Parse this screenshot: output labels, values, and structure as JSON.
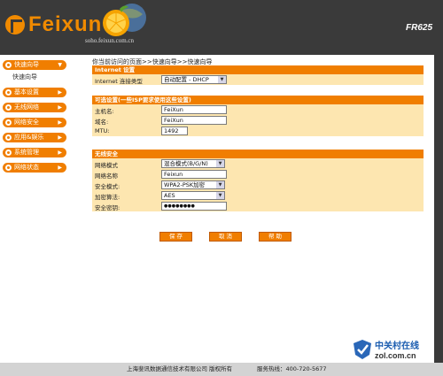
{
  "header": {
    "logo_text": "Feixun",
    "model": "FR625",
    "site": "soho.feixun.com.cn"
  },
  "sidebar": {
    "items": [
      {
        "label": "快速向导",
        "arrow": "▼",
        "sub": [
          "快速向导"
        ]
      },
      {
        "label": "基本设置",
        "arrow": "▶"
      },
      {
        "label": "无线网络",
        "arrow": "▶"
      },
      {
        "label": "网络安全",
        "arrow": "▶"
      },
      {
        "label": "应用&娱乐",
        "arrow": "▶"
      },
      {
        "label": "系统管理",
        "arrow": "▶"
      },
      {
        "label": "网络状态",
        "arrow": "▶"
      }
    ]
  },
  "breadcrumb": "你当前访问的页面>>快速向导>>快速向导",
  "internet": {
    "title": "Internet 设置",
    "conn_label": "Internet 连接类型",
    "conn_value": "自动配置 - DHCP"
  },
  "optional": {
    "title": "可选设置(一些ISP要求使用这些设置)",
    "host_label": "主机名:",
    "host_value": "FeiXun",
    "domain_label": "域名:",
    "domain_value": "FeiXun",
    "mtu_label": "MTU:",
    "mtu_value": "1492"
  },
  "wireless": {
    "title": "无线安全",
    "mode_label": "网络模式",
    "mode_value": "混合模式(B/G/N)",
    "ssid_label": "网络名称",
    "ssid_value": "Feixun",
    "security_label": "安全模式:",
    "security_value": "WPA2-PSK加密",
    "cipher_label": "加密算法:",
    "cipher_value": "AES",
    "key_label": "安全密钥:",
    "key_value": "●●●●●●●●"
  },
  "buttons": {
    "save": "保 存",
    "cancel": "取 消",
    "help": "帮 助"
  },
  "footer": {
    "company": "上海斐讯数据通信技术有限公司",
    "rights": "版权所有",
    "hotline": "服务热线：400-720-5677"
  },
  "watermark": {
    "cn": "中关村在线",
    "en": "zol.com.cn"
  },
  "colors": {
    "accent": "#f07e00",
    "panel_bg": "#fde6b0",
    "header_bg": "#3a3a3a"
  }
}
